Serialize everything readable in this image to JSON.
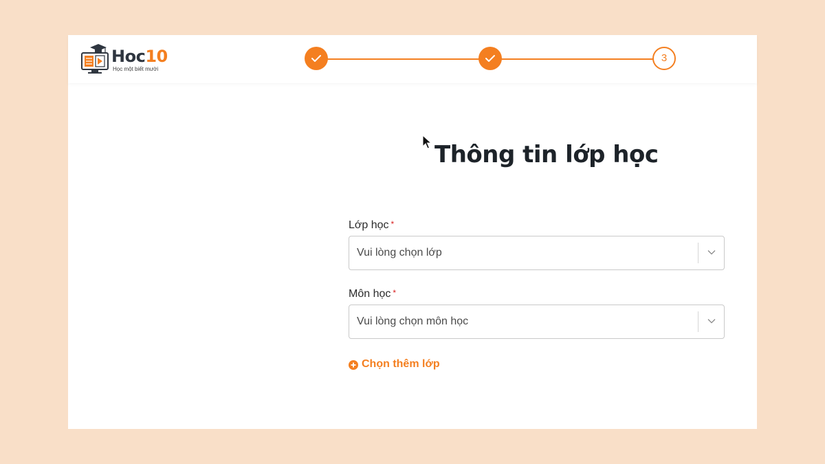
{
  "brand": {
    "name_part1": "Hoc",
    "name_part2": "10",
    "tagline": "Học một biết mười",
    "accent_color": "#f47f20"
  },
  "stepper": {
    "steps": [
      {
        "state": "completed",
        "icon": "check-icon"
      },
      {
        "state": "completed",
        "icon": "check-icon"
      },
      {
        "state": "current",
        "label": "3"
      }
    ]
  },
  "form": {
    "title": "Thông tin lớp học",
    "class_field": {
      "label": "Lớp học",
      "required_mark": "*",
      "placeholder": "Vui lòng chọn lớp",
      "icon": "chevron-down-icon"
    },
    "subject_field": {
      "label": "Môn học",
      "required_mark": "*",
      "placeholder": "Vui lòng chọn môn học",
      "icon": "chevron-down-icon"
    },
    "add_more": {
      "label": "Chọn thêm lớp",
      "icon": "plus-circle-icon"
    }
  }
}
